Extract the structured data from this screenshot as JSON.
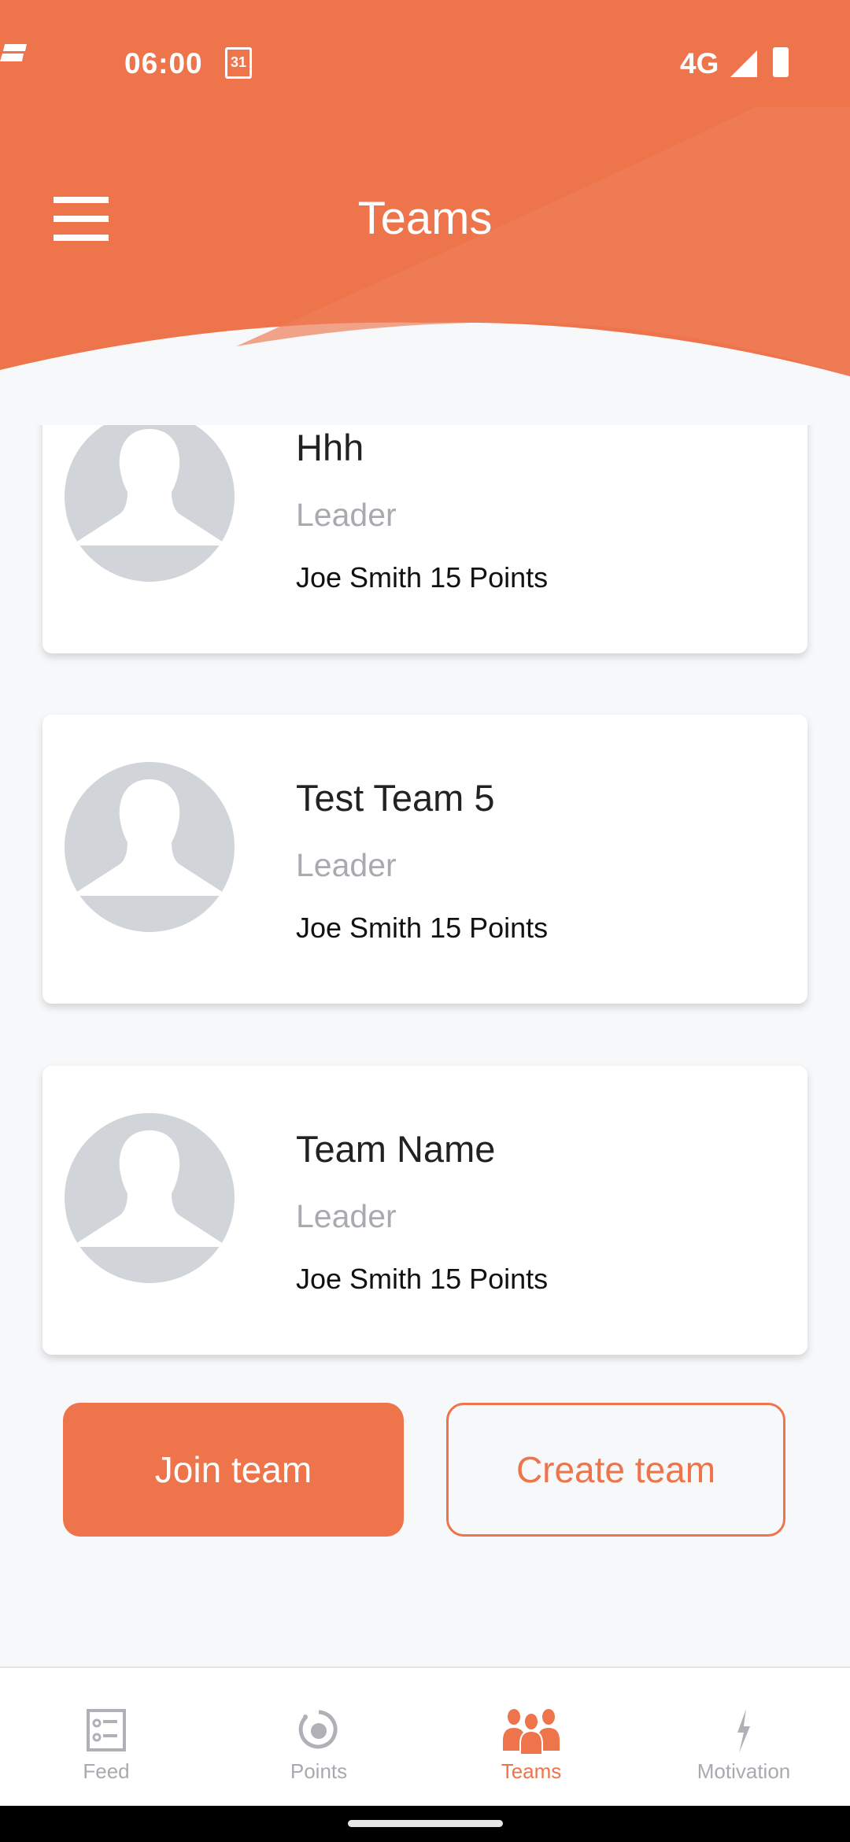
{
  "status_bar": {
    "time": "06:00",
    "calendar_day": "31",
    "network": "4G"
  },
  "header": {
    "title": "Teams"
  },
  "teams": [
    {
      "name": "Hhh",
      "role": "Leader",
      "leader_points": "Joe Smith 15 Points"
    },
    {
      "name": "Test Team 5",
      "role": "Leader",
      "leader_points": "Joe Smith 15 Points"
    },
    {
      "name": "Team Name",
      "role": "Leader",
      "leader_points": "Joe Smith 15 Points"
    }
  ],
  "actions": {
    "join": "Join team",
    "create": "Create team"
  },
  "nav": [
    {
      "label": "Feed",
      "icon": "feed-icon"
    },
    {
      "label": "Points",
      "icon": "points-icon"
    },
    {
      "label": "Teams",
      "icon": "teams-icon",
      "active": true
    },
    {
      "label": "Motivation",
      "icon": "lightning-icon"
    }
  ],
  "colors": {
    "accent": "#ed744b",
    "background": "#f7f8fa"
  }
}
